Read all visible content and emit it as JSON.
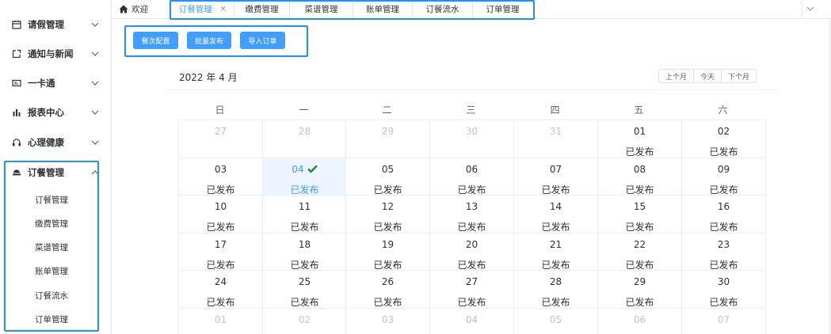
{
  "sidebar": {
    "menu": [
      {
        "label": "请假管理",
        "icon": "calendar-icon"
      },
      {
        "label": "通知与新闻",
        "icon": "external-link-icon"
      },
      {
        "label": "一卡通",
        "icon": "card-icon"
      },
      {
        "label": "报表中心",
        "icon": "bar-chart-icon"
      },
      {
        "label": "心理健康",
        "icon": "headset-icon"
      },
      {
        "label": "订餐管理",
        "icon": "food-icon",
        "expanded": true
      }
    ],
    "submenu": [
      "订餐管理",
      "缴费管理",
      "菜谱管理",
      "账单管理",
      "订餐流水",
      "订单管理"
    ]
  },
  "tabs": {
    "home": "欢迎",
    "items": [
      "订餐管理",
      "缴费管理",
      "菜谱管理",
      "账单管理",
      "订餐流水",
      "订单管理"
    ],
    "active_index": 0
  },
  "actions": {
    "meal_config": "餐次配置",
    "batch_publish": "批量发布",
    "import_orders": "导入订单"
  },
  "calendar": {
    "title": "2022 年 4 月",
    "nav": {
      "prev": "上个月",
      "today": "今天",
      "next": "下个月"
    },
    "weekdays": [
      "日",
      "一",
      "二",
      "三",
      "四",
      "五",
      "六"
    ],
    "weeks": [
      [
        {
          "d": "27",
          "dim": true
        },
        {
          "d": "28",
          "dim": true
        },
        {
          "d": "29",
          "dim": true
        },
        {
          "d": "30",
          "dim": true
        },
        {
          "d": "31",
          "dim": true
        },
        {
          "d": "01",
          "s": "已发布"
        },
        {
          "d": "02",
          "s": "已发布"
        }
      ],
      [
        {
          "d": "03",
          "s": "已发布"
        },
        {
          "d": "04",
          "s": "已发布",
          "selected": true
        },
        {
          "d": "05",
          "s": "已发布"
        },
        {
          "d": "06",
          "s": "已发布"
        },
        {
          "d": "07",
          "s": "已发布"
        },
        {
          "d": "08",
          "s": "已发布"
        },
        {
          "d": "09",
          "s": "已发布"
        }
      ],
      [
        {
          "d": "10",
          "s": "已发布"
        },
        {
          "d": "11",
          "s": "已发布"
        },
        {
          "d": "12",
          "s": "已发布"
        },
        {
          "d": "13",
          "s": "已发布"
        },
        {
          "d": "14",
          "s": "已发布"
        },
        {
          "d": "15",
          "s": "已发布"
        },
        {
          "d": "16",
          "s": "已发布"
        }
      ],
      [
        {
          "d": "17",
          "s": "已发布"
        },
        {
          "d": "18",
          "s": "已发布"
        },
        {
          "d": "19",
          "s": "已发布"
        },
        {
          "d": "20",
          "s": "已发布"
        },
        {
          "d": "21",
          "s": "已发布"
        },
        {
          "d": "22",
          "s": "已发布"
        },
        {
          "d": "23",
          "s": "已发布"
        }
      ],
      [
        {
          "d": "24",
          "s": "已发布"
        },
        {
          "d": "25",
          "s": "已发布"
        },
        {
          "d": "26",
          "s": "已发布"
        },
        {
          "d": "27",
          "s": "已发布"
        },
        {
          "d": "28",
          "s": "已发布"
        },
        {
          "d": "29",
          "s": "已发布"
        },
        {
          "d": "30",
          "s": "已发布"
        }
      ],
      [
        {
          "d": "01",
          "dim": true
        },
        {
          "d": "02",
          "dim": true
        },
        {
          "d": "03",
          "dim": true
        },
        {
          "d": "04",
          "dim": true
        },
        {
          "d": "05",
          "dim": true
        },
        {
          "d": "06",
          "dim": true
        },
        {
          "d": "07",
          "dim": true
        }
      ]
    ]
  },
  "colors": {
    "primary": "#409eff",
    "highlight_box": "#1e90ff",
    "check": "#1a8c3a"
  }
}
